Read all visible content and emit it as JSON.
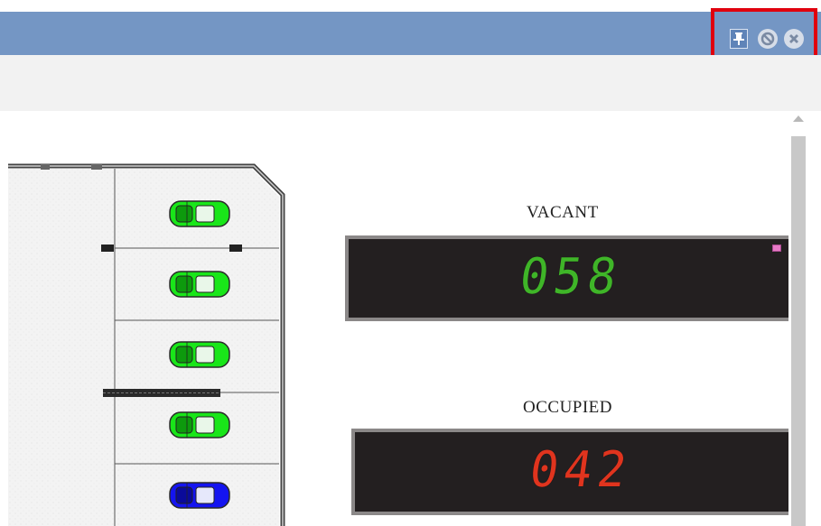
{
  "window": {
    "controls": [
      {
        "icon": "pin-icon"
      },
      {
        "icon": "minimize-icon"
      },
      {
        "icon": "close-icon"
      }
    ],
    "highlight_color": "#e0000e",
    "titlebar_color": "#7496c4"
  },
  "parking": {
    "spots": [
      {
        "status": "vacant",
        "color": "#19e619"
      },
      {
        "status": "vacant",
        "color": "#19e619"
      },
      {
        "status": "vacant",
        "color": "#19e619"
      },
      {
        "status": "vacant",
        "color": "#19e619"
      },
      {
        "status": "occupied",
        "color": "#1414f0"
      }
    ]
  },
  "display": {
    "vacant": {
      "label": "VACANT",
      "count": "058",
      "color": "#3fb528"
    },
    "occupied": {
      "label": "OCCUPIED",
      "count": "042",
      "color": "#e0341e"
    }
  }
}
